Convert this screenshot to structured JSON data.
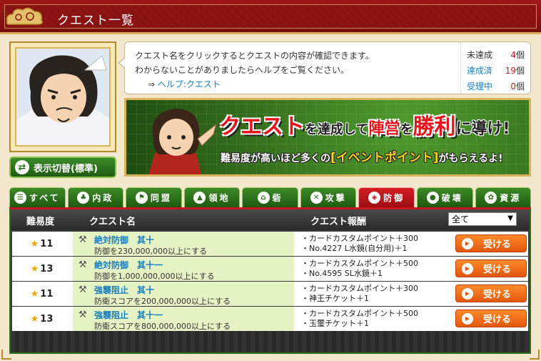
{
  "header": {
    "title": "クエスト一覧"
  },
  "portrait": {
    "toggle_label": "表示切替(標準)"
  },
  "info": {
    "line1": "クエスト名をクリックするとクエストの内容が確認できます。",
    "line2": "わからないことがありましたらヘルプをご覧ください。",
    "help_arrow": "⇒",
    "help_link": "ヘルプ:クエスト",
    "stats": [
      {
        "label": "未達成",
        "value": "4",
        "unit": "個",
        "link": false
      },
      {
        "label": "達成済",
        "value": "19",
        "unit": "個",
        "link": true
      },
      {
        "label": "受理中",
        "value": "0",
        "unit": "個",
        "link": true
      }
    ]
  },
  "banner": {
    "big_1": "クエスト",
    "small_1": "を達成して",
    "big_2": "陣営",
    "small_2": "を",
    "big_3": "勝利",
    "small_3": "に導け!",
    "line2_a": "難易度が高いほど多くの",
    "line2_b": "[イベントポイント]",
    "line2_c": "がもらえるよ!"
  },
  "tabs": [
    {
      "label": "すべて",
      "icon": "list-icon",
      "glyph": "☰",
      "active": false
    },
    {
      "label": "内政",
      "icon": "tree-icon",
      "glyph": "♣",
      "active": false
    },
    {
      "label": "同盟",
      "icon": "flag-icon",
      "glyph": "⚑",
      "active": false
    },
    {
      "label": "領地",
      "icon": "map-icon",
      "glyph": "▲",
      "active": false
    },
    {
      "label": "砦",
      "icon": "fort-icon",
      "glyph": "⌂",
      "active": false
    },
    {
      "label": "攻撃",
      "icon": "swords-icon",
      "glyph": "✕",
      "active": false
    },
    {
      "label": "防御",
      "icon": "shield-icon",
      "glyph": "◈",
      "active": true
    },
    {
      "label": "破壊",
      "icon": "bomb-icon",
      "glyph": "●",
      "active": false
    },
    {
      "label": "資源",
      "icon": "wheat-icon",
      "glyph": "✿",
      "active": false
    }
  ],
  "table": {
    "headers": {
      "level": "難易度",
      "name": "クエスト名",
      "reward": "クエスト報酬"
    },
    "filter_value": "全て",
    "accept_label": "受ける",
    "rows": [
      {
        "level": "11",
        "title": "絶対防御　其十",
        "desc": "防御を230,000,000以上にする",
        "reward1": "・カードカスタムポイント＋300",
        "reward2": "・No.4227 L水鏡(自分用)＋1"
      },
      {
        "level": "13",
        "title": "絶対防御　其十一",
        "desc": "防御を1,000,000,000以上にする",
        "reward1": "・カードカスタムポイント＋500",
        "reward2": "・No.4595 SL水鏡＋1"
      },
      {
        "level": "11",
        "title": "強襲阻止　其十",
        "desc": "防衛スコアを200,000,000以上にする",
        "reward1": "・カードカスタムポイント＋300",
        "reward2": "・神王チケット＋1"
      },
      {
        "level": "13",
        "title": "強襲阻止　其十一",
        "desc": "防衛スコアを800,000,000以上にする",
        "reward1": "・カードカスタムポイント＋500",
        "reward2": "・玉璽チケット＋1"
      }
    ]
  },
  "colors": {
    "header_red": "#8d1414",
    "tab_green": "#2d6f1c",
    "tab_active_red": "#c8161d",
    "accept_orange": "#f07020",
    "link_blue": "#1a7fbf"
  }
}
